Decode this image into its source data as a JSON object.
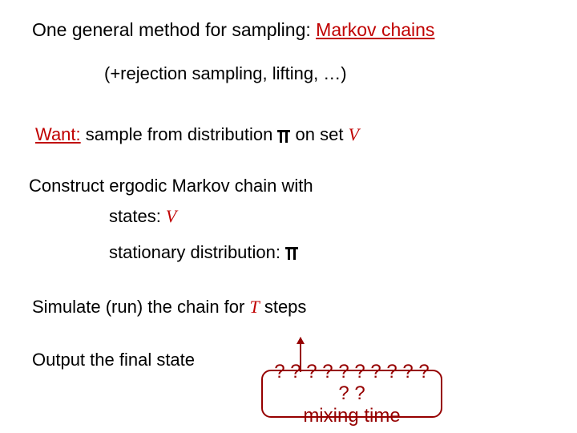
{
  "title_prefix": "One general method for sampling: ",
  "title_emph": "Markov chains",
  "subline": "(+rejection sampling, lifting, …)",
  "want_label": "Want:",
  "want_rest_a": " sample from distribution ",
  "want_rest_b": " on set ",
  "var_V": "V",
  "construct": "Construct ergodic Markov chain with",
  "states_label": "states: ",
  "stationary_label": "stationary distribution: ",
  "simulate_a": "Simulate (run) the chain for ",
  "var_T": "T",
  "simulate_b": " steps",
  "output_line": "Output the final state",
  "callout": "? ? ? ? ? ? ? ? ? ? ? ?\nmixing time"
}
